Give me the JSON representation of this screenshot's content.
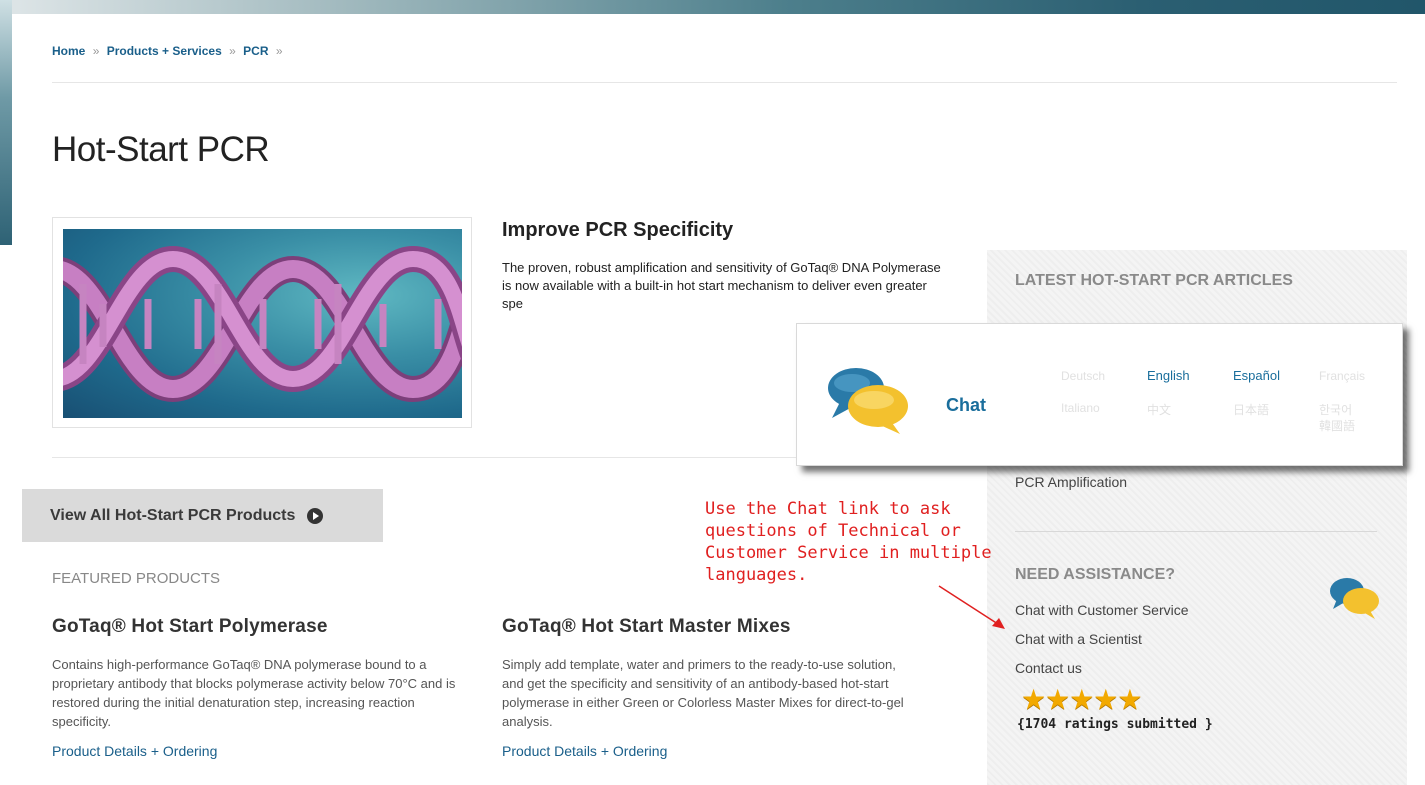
{
  "breadcrumb": {
    "items": [
      "Home",
      "Products + Services",
      "PCR"
    ],
    "separator": "»"
  },
  "page_title": "Hot-Start PCR",
  "hero": {
    "heading": "Improve PCR Specificity",
    "text": "The proven, robust amplification and sensitivity of GoTaq® DNA Polymerase is now available with a built-in hot start mechanism to deliver even greater spe"
  },
  "view_all_button": "View All Hot-Start PCR Products",
  "featured": {
    "label": "FEATURED PRODUCTS",
    "products": [
      {
        "title": "GoTaq® Hot Start Polymerase",
        "description": "Contains high-performance GoTaq® DNA polymerase bound to a proprietary antibody that blocks polymerase activity below 70°C and is restored during the initial denaturation step, increasing reaction specificity.",
        "link": "Product Details + Ordering"
      },
      {
        "title": "GoTaq® Hot Start Master Mixes",
        "description": "Simply add template, water and primers to the ready-to-use solution, and get the specificity and sensitivity of an antibody-based hot-start polymerase in either Green or Colorless Master Mixes for direct-to-gel analysis.",
        "link": "Product Details + Ordering"
      }
    ]
  },
  "sidebar": {
    "latest_heading": "LATEST HOT-START PCR ARTICLES",
    "article": "PCR Amplification",
    "assistance_heading": "NEED ASSISTANCE?",
    "links": [
      "Chat with Customer Service",
      "Chat with a Scientist",
      "Contact us"
    ],
    "stars": "★★★★★",
    "rating_value": 5,
    "ratings_text": "{1704 ratings submitted }"
  },
  "chat_popup": {
    "label": "Chat",
    "languages": [
      "Deutsch",
      "English",
      "Español",
      "Français",
      "Italiano",
      "中文",
      "日本語",
      "한국어",
      "韓國語"
    ],
    "active_languages": [
      "English",
      "Español"
    ]
  },
  "annotation": {
    "text": "Use the Chat link to ask questions of Technical or Customer Service in multiple languages."
  },
  "colors": {
    "link": "#1a5f8a",
    "annotation": "#e02020",
    "star": "#f2a900",
    "chat_blue": "#2a7aa8",
    "chat_yellow": "#f3c12e"
  }
}
